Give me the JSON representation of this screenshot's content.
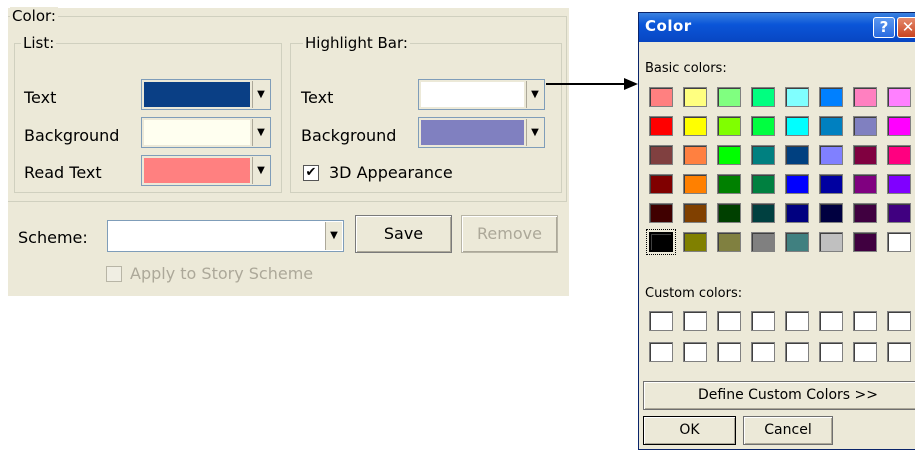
{
  "color_group": {
    "title": "Color:",
    "list": {
      "title": "List:",
      "rows": [
        {
          "label": "Text",
          "color": "#0a3f85"
        },
        {
          "label": "Background",
          "color": "#fffff0"
        },
        {
          "label": "Read Text",
          "color": "#ff8080"
        }
      ]
    },
    "highlight": {
      "title": "Highlight Bar:",
      "rows": [
        {
          "label": "Text",
          "color": "#ffffff"
        },
        {
          "label": "Background",
          "color": "#8080c0"
        }
      ],
      "appearance_3d": {
        "label": "3D Appearance",
        "checked": true
      }
    }
  },
  "scheme": {
    "label": "Scheme:",
    "value": "",
    "save_label": "Save",
    "remove_label": "Remove",
    "apply_story": {
      "label": "Apply to Story Scheme",
      "checked": false,
      "enabled": false
    }
  },
  "dialog": {
    "title": "Color",
    "help_glyph": "?",
    "close_glyph": "✕",
    "basic_colors_label": "Basic colors:",
    "basic_colors": [
      [
        "#ff8080",
        "#ffff80",
        "#80ff80",
        "#00ff80",
        "#80ffff",
        "#0080ff",
        "#ff80c0",
        "#ff80ff"
      ],
      [
        "#ff0000",
        "#ffff00",
        "#80ff00",
        "#00ff40",
        "#00ffff",
        "#0080c0",
        "#8080c0",
        "#ff00ff"
      ],
      [
        "#804040",
        "#ff8040",
        "#00ff00",
        "#008080",
        "#004080",
        "#8080ff",
        "#800040",
        "#ff0080"
      ],
      [
        "#800000",
        "#ff8000",
        "#008000",
        "#008040",
        "#0000ff",
        "#0000a0",
        "#800080",
        "#8000ff"
      ],
      [
        "#400000",
        "#804000",
        "#004000",
        "#004040",
        "#000080",
        "#000040",
        "#400040",
        "#400080"
      ],
      [
        "#000000",
        "#808000",
        "#808040",
        "#808080",
        "#408080",
        "#c0c0c0",
        "#400040",
        "#ffffff"
      ]
    ],
    "selected_color": "#000000",
    "custom_colors_label": "Custom colors:",
    "define_custom_label": "Define Custom Colors >>",
    "ok_label": "OK",
    "cancel_label": "Cancel"
  }
}
